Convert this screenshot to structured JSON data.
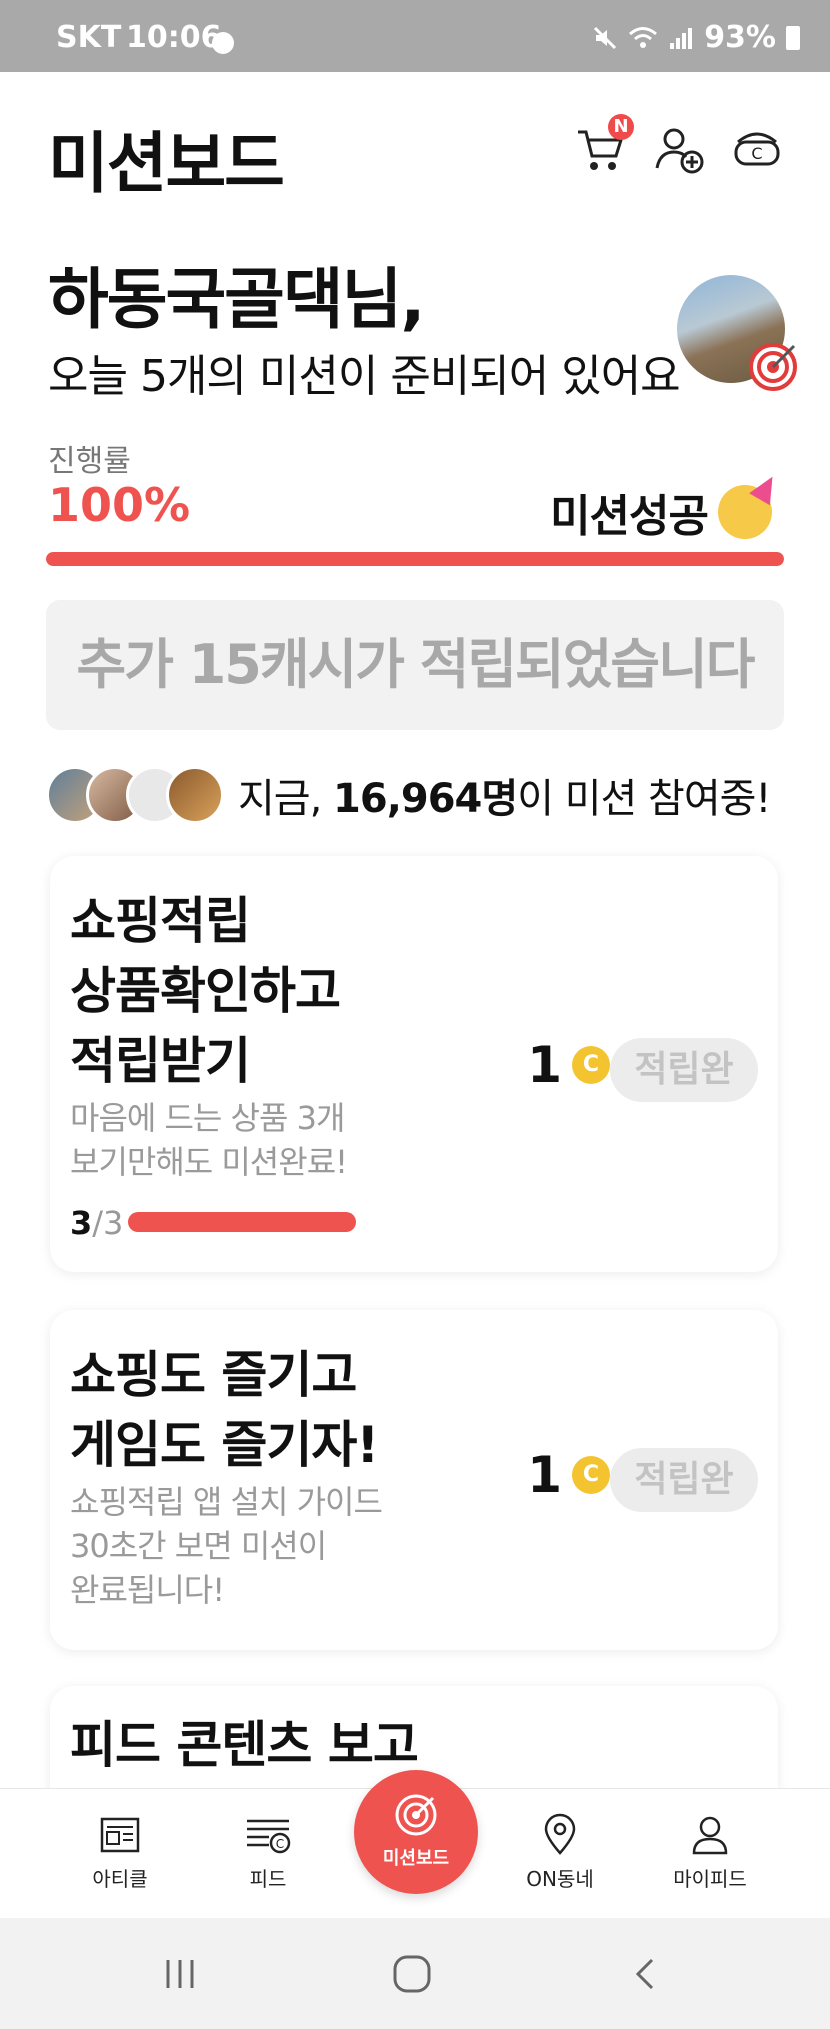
{
  "status_bar": {
    "carrier": "SKT",
    "time": "10:06",
    "battery": "93%"
  },
  "header": {
    "title": "미션보드",
    "cart_badge": "N",
    "icons": [
      "cart-icon",
      "add-friend-icon",
      "cash-icon"
    ]
  },
  "greeting": {
    "name": "하동국골댁님,",
    "subtitle": "오늘 5개의 미션이 준비되어 있어요"
  },
  "progress": {
    "label": "진행률",
    "percent_text": "100%",
    "value": 1.0,
    "status": "미션성공"
  },
  "notice": "추가 15캐시가 적립되었습니다",
  "participants": {
    "prefix": "지금, ",
    "count": "16,964명",
    "suffix": "이 미션 참여중!"
  },
  "missions": [
    {
      "title_lines": [
        "쇼핑적립",
        "상품확인하고",
        "적립받기"
      ],
      "desc_lines": [
        "마음에 드는 상품 3개",
        "보기만해도 미션완료!"
      ],
      "progress_done": "3",
      "progress_total": "/3",
      "reward": "1",
      "coin": "C",
      "button": "적립완"
    },
    {
      "title_lines": [
        "쇼핑도 즐기고",
        "게임도 즐기자!"
      ],
      "desc_lines": [
        "쇼핑적립 앱 설치 가이드",
        "30초간 보면 미션이",
        "완료됩니다!"
      ],
      "reward": "1",
      "coin": "C",
      "button": "적립완"
    },
    {
      "title_lines": [
        "피드 콘텐츠 보고"
      ]
    }
  ],
  "bottom_nav": [
    {
      "label": "아티클",
      "icon": "article-icon"
    },
    {
      "label": "피드",
      "icon": "feed-icon"
    },
    {
      "label": "미션보드",
      "icon": "target-icon"
    },
    {
      "label": "ON동네",
      "icon": "location-pin-icon"
    },
    {
      "label": "마이피드",
      "icon": "profile-icon"
    }
  ],
  "colors": {
    "accent": "#ef5350",
    "muted": "#9a9a9a",
    "coin": "#f4c430"
  }
}
